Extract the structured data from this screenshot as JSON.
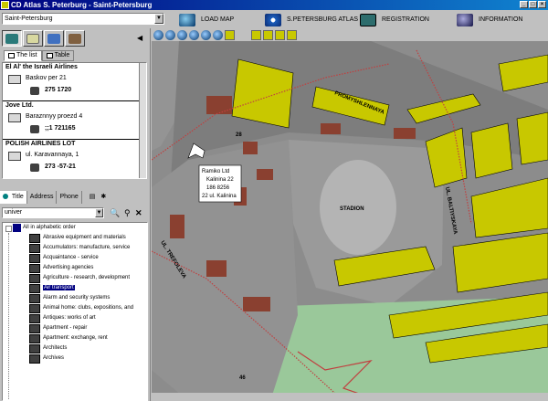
{
  "window": {
    "title": "CD Atlas S. Peterburg - Saint-Petersburg"
  },
  "city_select": {
    "value": "Saint-Petersburg"
  },
  "top_buttons": [
    {
      "label": "Load map"
    },
    {
      "label": "S.Petersburg atlas"
    },
    {
      "label": "Registration"
    },
    {
      "label": "Information"
    }
  ],
  "panel_tabs": {
    "list": "The list",
    "table": "Table"
  },
  "entries": [
    {
      "name": "El Al' the Israeli Airlines",
      "address": "Baskov per 21",
      "phone": "275 1720"
    },
    {
      "name": "Jove Ltd.",
      "address": "Baraznnyy proezd 4",
      "phone": ";;1 721165"
    },
    {
      "name": "POLISH AIRLINES LOT",
      "address": "ul. Karavannaya, 1",
      "phone": "273 -57-21"
    }
  ],
  "search_tabs": {
    "title": "Title",
    "address": "Address",
    "phone": "Phone"
  },
  "search": {
    "value": "univer"
  },
  "tree": {
    "root": "All in alphabetic order",
    "items": [
      "Abrasive equipment and materials",
      "Accumulators: manufacture, service",
      "Acquaintance - service",
      "Advertising agencies",
      "Agriculture - research, development",
      "Air transport",
      "Alarm and security systems",
      "Animal home: clubs, expositions, and",
      "Antiques: works of art",
      "Apartment - repair",
      "Apartment: exchange, rent",
      "Architects",
      "Archives"
    ],
    "selected_index": 5
  },
  "map": {
    "street_top": "PROMYSHLENNAYA",
    "street_left": "UL. TREFOLEVA",
    "street_right": "UL. BALTIYSKAYA",
    "stadium": "STADION",
    "building_no": "28",
    "bottom_no": "46",
    "popup": {
      "line1": "Ramiko Ltd",
      "line2": "Kalinina 22",
      "line3": "186 8256",
      "line4": "22 ul. Kalinina"
    },
    "colors": {
      "background": "#808080",
      "building": "#c8c800",
      "accent_red": "#c04040",
      "park": "#9ac89a",
      "water": "#1a4aa0"
    }
  }
}
